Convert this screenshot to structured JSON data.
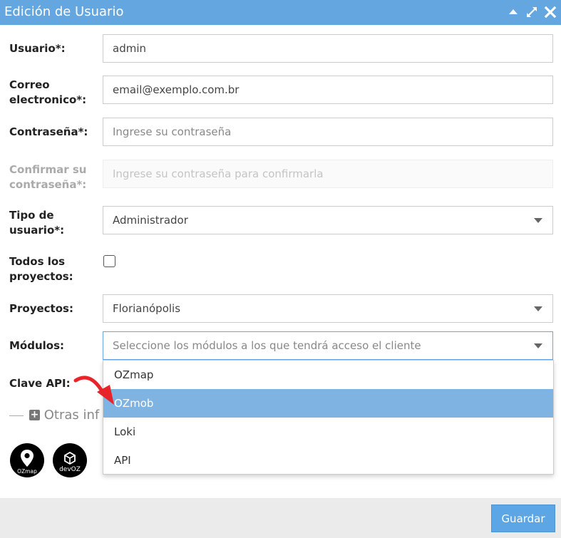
{
  "dialog": {
    "title": "Edición de Usuario"
  },
  "form": {
    "usuario": {
      "label": "Usuario*:",
      "value": "admin"
    },
    "correo": {
      "label_line1": "Correo",
      "label_line2": "electronico*:",
      "value": "email@exemplo.com.br"
    },
    "contrasena": {
      "label": "Contraseña*:",
      "placeholder": "Ingrese su contraseña"
    },
    "confirmar": {
      "label_line1": "Confirmar su",
      "label_line2": "contraseña*:",
      "placeholder": "Ingrese su contraseña para confirmarla"
    },
    "tipo": {
      "label_line1": "Tipo de",
      "label_line2": "usuario*:",
      "value": "Administrador"
    },
    "todos": {
      "label_line1": "Todos los",
      "label_line2": "proyectos:",
      "checked": false
    },
    "proyectos": {
      "label": "Proyectos:",
      "value": "Florianópolis"
    },
    "modulos": {
      "label": "Módulos:",
      "placeholder": "Seleccione los módulos a los que tendrá acceso el cliente",
      "options": [
        "OZmap",
        "OZmob",
        "Loki",
        "API"
      ],
      "highlighted": "OZmob"
    },
    "clave_api": {
      "label": "Clave API:"
    },
    "otras_info": "Otras inf"
  },
  "logos": [
    {
      "icon": "ozmap-logo",
      "text": "OZmap"
    },
    {
      "icon": "devoz-logo",
      "text": "devOZ"
    }
  ],
  "footer": {
    "save_label": "Guardar"
  },
  "colors": {
    "accent": "#64a6e0",
    "highlight": "#7fb3e2",
    "arrow": "#e8232a"
  }
}
